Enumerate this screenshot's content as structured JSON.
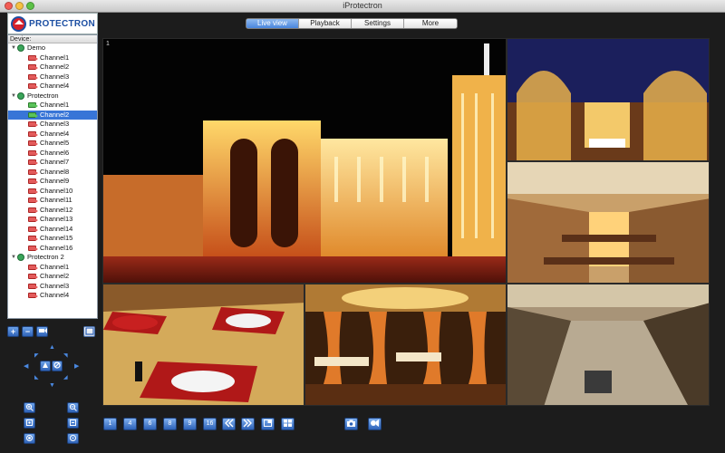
{
  "window": {
    "title": "iProtectron"
  },
  "logo": {
    "text": "PROTECTRON"
  },
  "tabs": [
    {
      "label": "Live view",
      "active": true
    },
    {
      "label": "Playback",
      "active": false
    },
    {
      "label": "Settings",
      "active": false
    },
    {
      "label": "More",
      "active": false
    }
  ],
  "device_tree": {
    "header": "Device:",
    "groups": [
      {
        "name": "Demo",
        "channels": [
          "Channel1",
          "Channel2",
          "Channel3",
          "Channel4"
        ]
      },
      {
        "name": "Protectron",
        "channels": [
          "Channel1",
          "Channel2",
          "Channel3",
          "Channel4",
          "Channel5",
          "Channel6",
          "Channel7",
          "Channel8",
          "Channel9",
          "Channel10",
          "Channel11",
          "Channel12",
          "Channel13",
          "Channel14",
          "Channel15",
          "Channel16"
        ]
      },
      {
        "name": "Protectron 2",
        "channels": [
          "Channel1",
          "Channel2",
          "Channel3",
          "Channel4"
        ]
      }
    ],
    "selected": {
      "group": "Protectron",
      "channel": "Channel2"
    }
  },
  "video": {
    "first_cell_number": "1"
  },
  "left_controls": {
    "top_buttons": [
      "add-icon",
      "remove-icon",
      "ptz-icon",
      "fullscreen-icon"
    ],
    "zoom_buttons": [
      "zoom-in-icon",
      "zoom-out-icon",
      "focus-near-icon",
      "focus-far-icon",
      "iris-open-icon",
      "iris-close-icon"
    ]
  },
  "bottom_toolbar": {
    "layout_buttons": [
      "1",
      "4",
      "6",
      "8",
      "9",
      "16"
    ],
    "nav_buttons": [
      "prev-page-icon",
      "next-page-icon",
      "single-view-icon",
      "multi-view-icon"
    ],
    "snapshot_buttons": [
      "snapshot-icon",
      "record-icon"
    ]
  },
  "colors": {
    "accent": "#3875d7",
    "tab_active": "#4a86dd",
    "background": "#1c1c1c"
  }
}
